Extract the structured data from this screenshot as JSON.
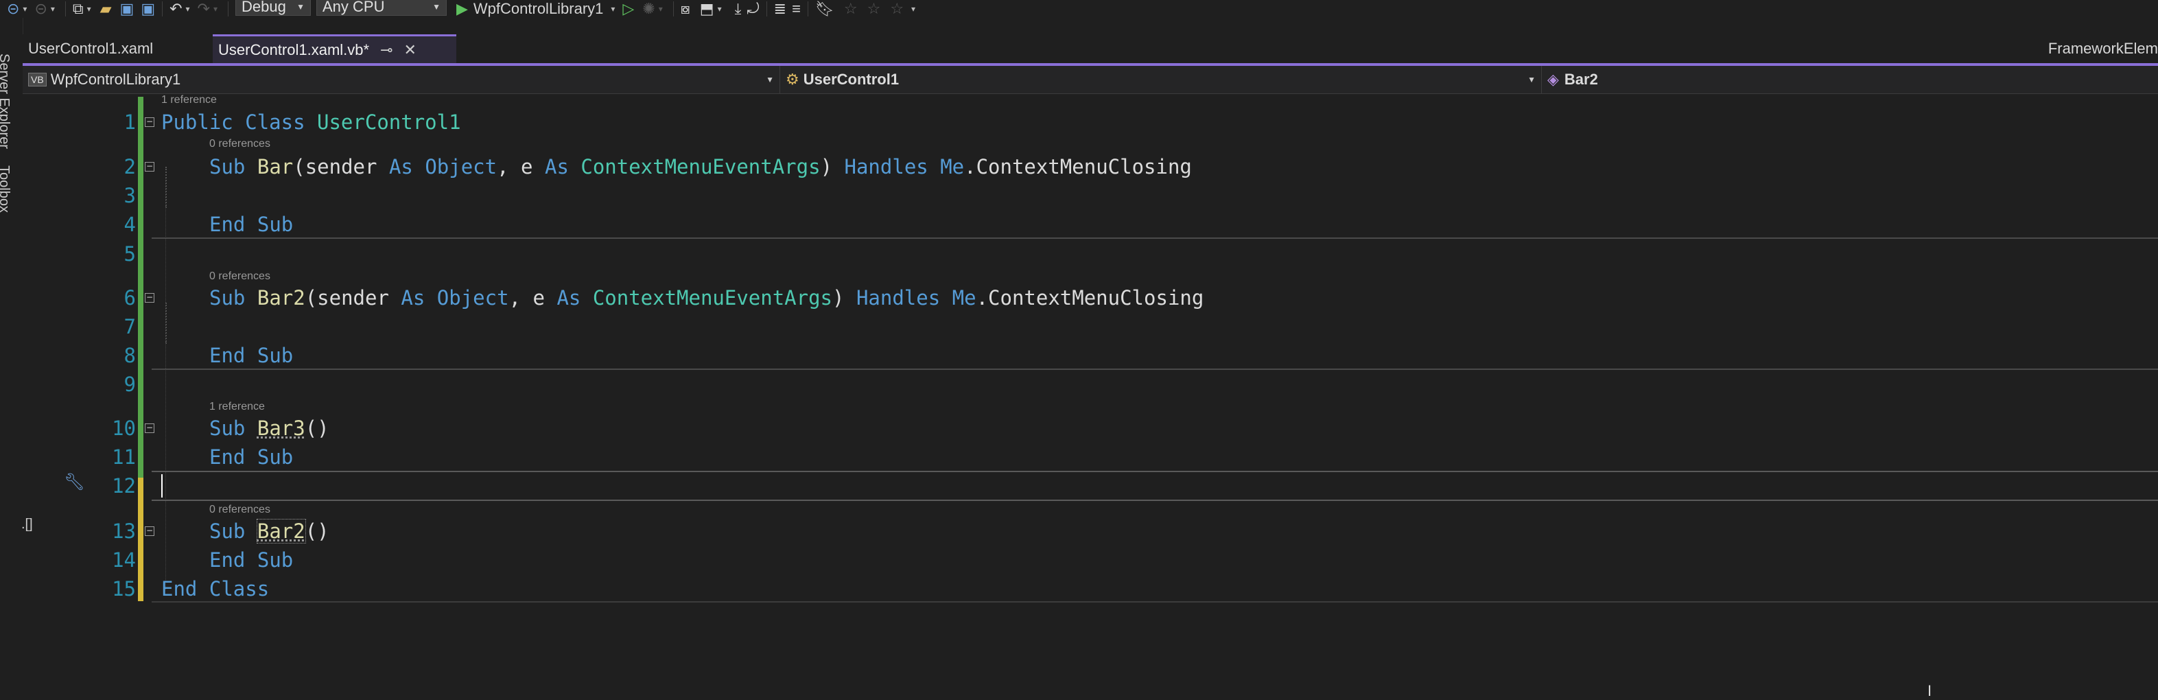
{
  "toolbar": {
    "config": "Debug",
    "platform": "Any CPU",
    "start_project": "WpfControlLibrary1"
  },
  "rail": {
    "server_explorer": "Server Explorer",
    "toolbox": "Toolbox"
  },
  "tabs": [
    {
      "label": "UserControl1.xaml",
      "active": false
    },
    {
      "label": "UserControl1.xaml.vb*",
      "active": true
    }
  ],
  "tab_right_label": "FrameworkElem",
  "navbar": {
    "project": "WpfControlLibrary1",
    "type": "UserControl1",
    "member": "Bar2"
  },
  "codelens": {
    "l1": "1 reference",
    "l2": "0 references",
    "l6": "0 references",
    "l10": "1 reference",
    "l13": "0 references"
  },
  "lines": [
    "1",
    "2",
    "3",
    "4",
    "5",
    "6",
    "7",
    "8",
    "9",
    "10",
    "11",
    "12",
    "13",
    "14",
    "15"
  ],
  "code": {
    "public": "Public",
    "class": "Class",
    "classname": "UserControl1",
    "sub": "Sub",
    "end": "End",
    "as": "As",
    "handles": "Handles",
    "me": "Me",
    "bar": "Bar",
    "bar2": "Bar2",
    "bar3": "Bar3",
    "sender": "sender",
    "e": "e",
    "object": "Object",
    "argtype": "ContextMenuEventArgs",
    "event": "ContextMenuClosing",
    "open_paren": "(",
    "close_paren": ")",
    "comma": ",",
    "dot": ".",
    "empty_parens": "()"
  },
  "colors": {
    "keyword": "#569cd6",
    "type": "#4ec9b0",
    "function": "#dcdcaa",
    "line_number": "#2b91af",
    "saved_change": "#57a64a",
    "unsaved_change": "#d7ba3a",
    "accent": "#8a6fd8"
  }
}
